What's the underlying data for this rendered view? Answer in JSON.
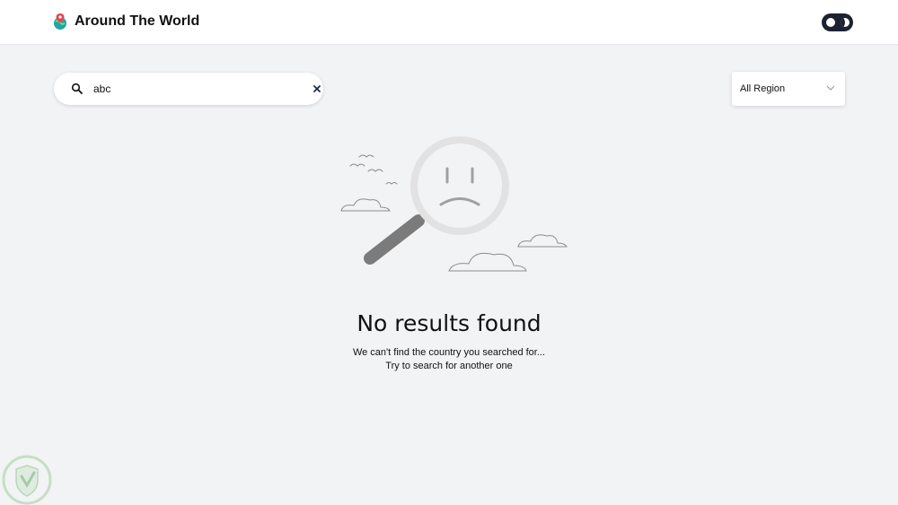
{
  "header": {
    "app_title": "Around The World",
    "logo_icon": "map-pin-globe-icon",
    "theme_toggle_icon": "moon-icon"
  },
  "search": {
    "value": "abc",
    "search_icon": "search-icon",
    "clear_icon": "close-icon"
  },
  "region_filter": {
    "selected": "All Region",
    "chevron_icon": "chevron-down-icon"
  },
  "empty_state": {
    "illustration_icon": "sad-magnifier-icon",
    "title": "No results found",
    "line1": "We can't find the country you searched for...",
    "line2": "Try to search for another one"
  },
  "colors": {
    "background": "#f2f3f5",
    "surface": "#ffffff",
    "text": "#111111",
    "toggle": "#1d2230",
    "illustration_gray": "#8c8c8c",
    "logo_teal": "#1fa6a6",
    "logo_red": "#e5484d"
  }
}
